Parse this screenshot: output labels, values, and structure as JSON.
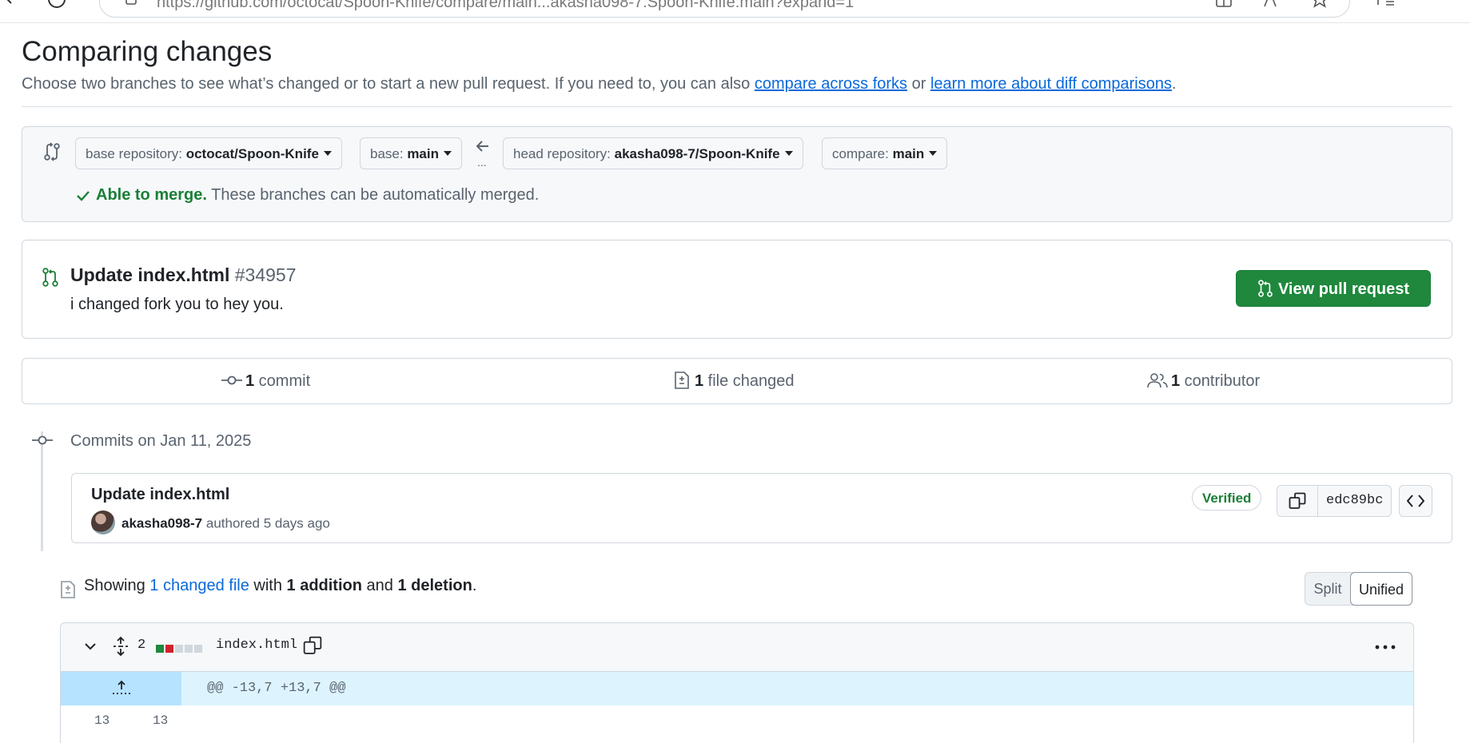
{
  "browser": {
    "url": "https://github.com/octocat/Spoon-Knife/compare/main...akasha098-7:Spoon-Knife:main?expand=1"
  },
  "header": {
    "title": "Comparing changes",
    "subtitle_prefix": "Choose two branches to see what’s changed or to start a new pull request. If you need to, you can also ",
    "link_forks": "compare across forks",
    "subtitle_or": " or ",
    "link_learn": "learn more about diff comparisons",
    "subtitle_end": "."
  },
  "compare": {
    "base_repo_label": "base repository: ",
    "base_repo_value": "octocat/Spoon-Knife",
    "base_label": "base: ",
    "base_value": "main",
    "head_repo_label": "head repository: ",
    "head_repo_value": "akasha098-7/Spoon-Knife",
    "compare_label": "compare: ",
    "compare_value": "main",
    "arrow_dots": "...",
    "merge_status": "Able to merge.",
    "merge_detail": " These branches can be automatically merged."
  },
  "pull_request": {
    "title": "Update index.html",
    "number": "#34957",
    "description": "i changed fork you to hey you.",
    "button_label": "View pull request"
  },
  "stats": {
    "commits_count": "1",
    "commits_label": " commit",
    "files_count": "1",
    "files_label": " file changed",
    "contributors_count": "1",
    "contributors_label": " contributor"
  },
  "commits": {
    "date_heading": "Commits on Jan 11, 2025",
    "items": [
      {
        "title": "Update index.html",
        "author": "akasha098-7",
        "meta": " authored 5 days ago",
        "badge": "Verified",
        "sha": "edc89bc"
      }
    ]
  },
  "diff_summary": {
    "prefix": "Showing ",
    "changed_files_link": "1 changed file",
    "with": " with ",
    "additions": "1 addition",
    "and": " and ",
    "deletions": "1 deletion",
    "end": ".",
    "split_label": "Split",
    "unified_label": "Unified"
  },
  "file": {
    "change_count": "2",
    "name": "index.html",
    "diffstat_colors": [
      "#1f883d",
      "#cf222e",
      "#d0d7de",
      "#d0d7de",
      "#d0d7de"
    ],
    "hunk_header": "@@ -13,7 +13,7 @@",
    "first_line_old": "13",
    "first_line_new": "13"
  },
  "colors": {
    "accent": "#0969da",
    "success": "#1f883d",
    "danger": "#cf222e"
  }
}
